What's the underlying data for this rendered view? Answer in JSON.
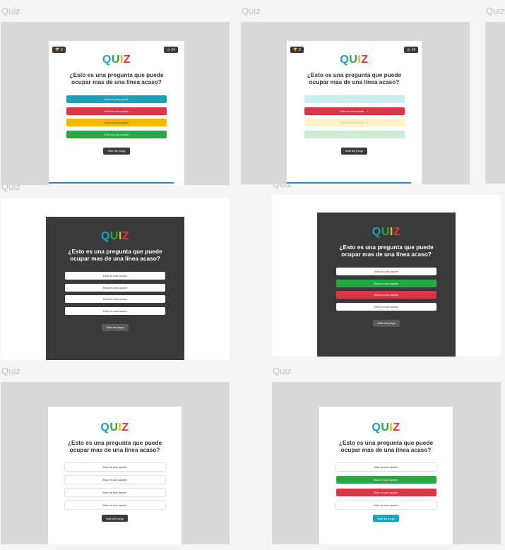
{
  "frames_label": "Quiz",
  "card": {
    "logo": [
      "Q",
      "U",
      "I",
      "Z"
    ],
    "logo_colors": [
      "#19a2b8",
      "#29a745",
      "#f5b800",
      "#dc3545"
    ],
    "question": "¿Esto es una pregunta que puede ocupar mas de una línea acaso?",
    "option_text": "Esto es una opción",
    "exit_label": "Salir del juego",
    "trophy_count": "2",
    "timer_value": "14",
    "check_mark": "✓",
    "cross_mark": "✕"
  },
  "colors": {
    "teal": "#19a2b8",
    "red": "#dc3545",
    "yellow": "#f5b800",
    "green": "#29a745",
    "dark": "#3a3a3a",
    "progress": "#1e88e5"
  }
}
